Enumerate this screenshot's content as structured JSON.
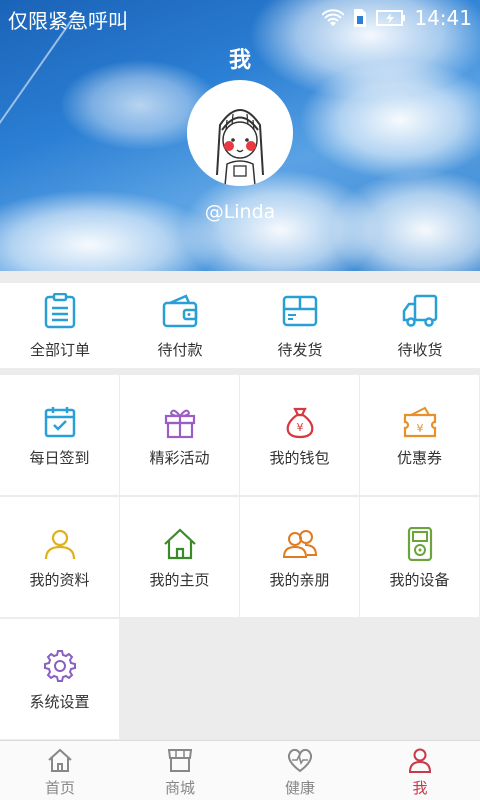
{
  "status_bar": {
    "carrier_text": "仅限紧急呼叫",
    "time": "14:41"
  },
  "header": {
    "title": "我",
    "username": "@Linda"
  },
  "orders": [
    {
      "label": "全部订单",
      "icon": "clipboard-icon"
    },
    {
      "label": "待付款",
      "icon": "wallet-icon"
    },
    {
      "label": "待发货",
      "icon": "box-icon"
    },
    {
      "label": "待收货",
      "icon": "truck-icon"
    }
  ],
  "menu": [
    {
      "label": "每日签到",
      "icon": "calendar-check-icon",
      "color": "#2aa0d8"
    },
    {
      "label": "精彩活动",
      "icon": "gift-icon",
      "color": "#9a5fc4"
    },
    {
      "label": "我的钱包",
      "icon": "money-bag-icon",
      "color": "#d9363e"
    },
    {
      "label": "优惠券",
      "icon": "coupon-icon",
      "color": "#e8912a"
    },
    {
      "label": "我的资料",
      "icon": "person-icon",
      "color": "#e0b020"
    },
    {
      "label": "我的主页",
      "icon": "home-icon",
      "color": "#3a8a2a"
    },
    {
      "label": "我的亲朋",
      "icon": "friends-icon",
      "color": "#e27a20"
    },
    {
      "label": "我的设备",
      "icon": "device-icon",
      "color": "#6aa43a"
    },
    {
      "label": "系统设置",
      "icon": "gear-icon",
      "color": "#8a5fc4"
    }
  ],
  "tabbar": [
    {
      "label": "首页",
      "icon": "home-tab-icon"
    },
    {
      "label": "商城",
      "icon": "shop-tab-icon"
    },
    {
      "label": "健康",
      "icon": "heart-pulse-tab-icon"
    },
    {
      "label": "我",
      "icon": "person-tab-icon",
      "active": true
    }
  ],
  "colors": {
    "accent_active": "#c8394a",
    "order_icon": "#2a9fd6",
    "tab_icon_inactive": "#888888"
  }
}
